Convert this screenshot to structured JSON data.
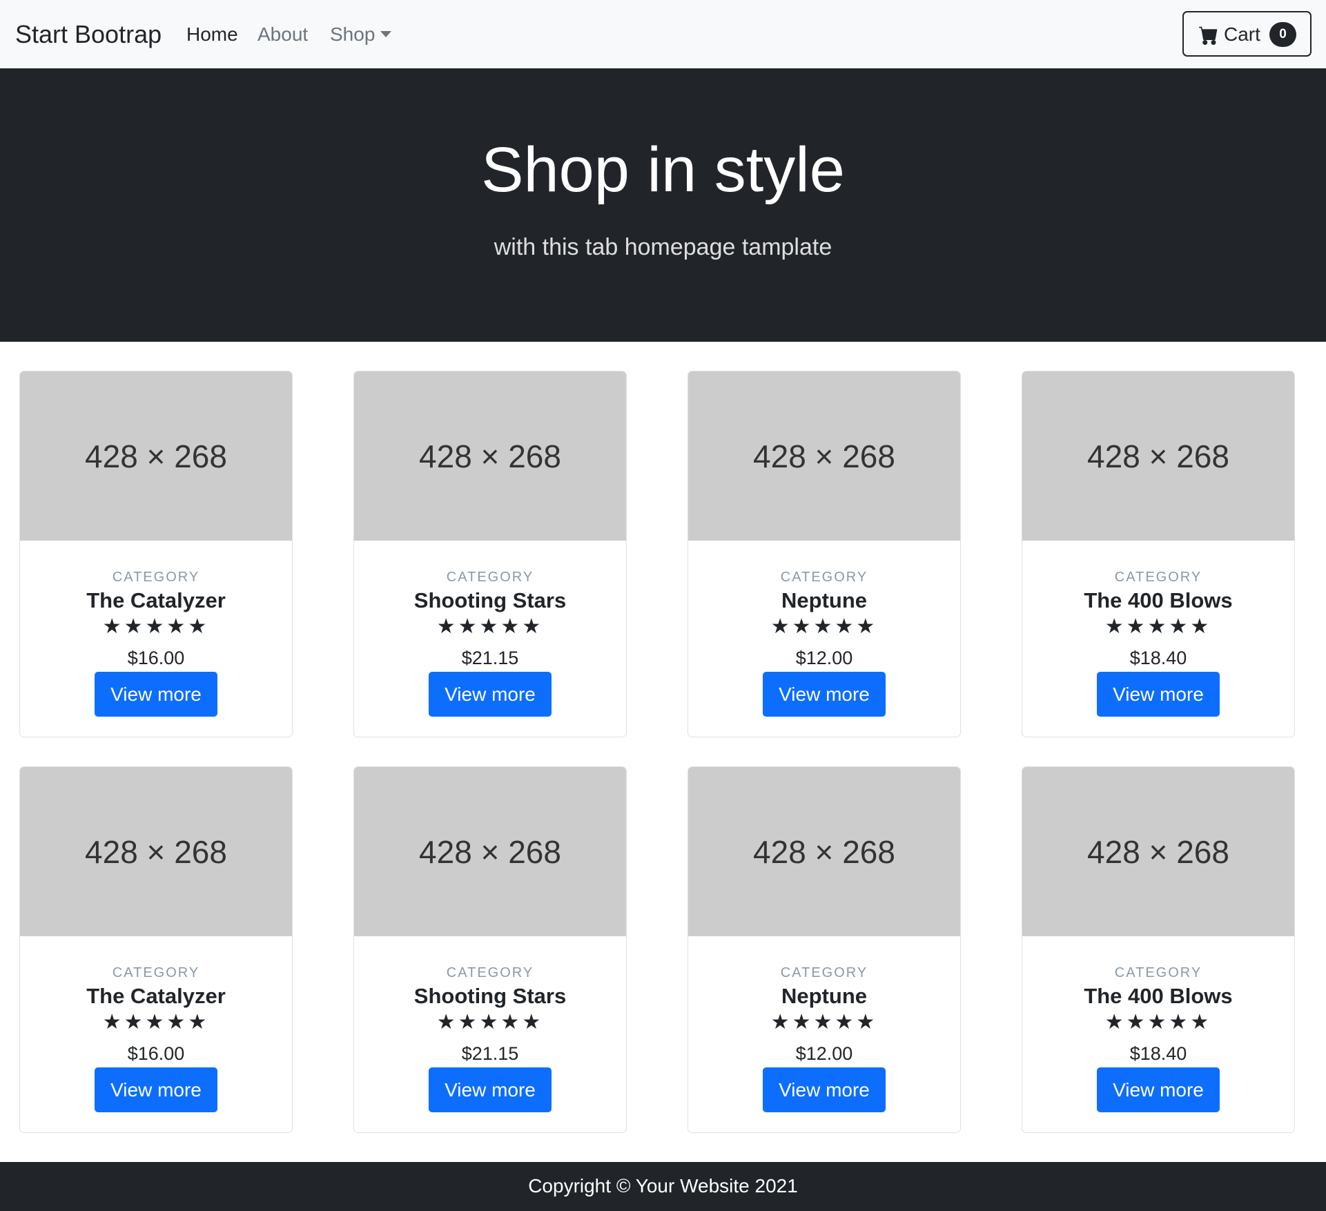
{
  "navbar": {
    "brand": "Start Bootrap",
    "links": {
      "home": "Home",
      "about": "About",
      "shop": "Shop"
    },
    "cart": {
      "label": "Cart",
      "count": "0"
    }
  },
  "hero": {
    "title": "Shop in style",
    "subtitle": "with this tab homepage tamplate"
  },
  "products": [
    {
      "image_text": "428 × 268",
      "category": "CATEGORY",
      "name": "The Catalyzer",
      "stars": "★★★★★",
      "price": "$16.00",
      "button": "View more"
    },
    {
      "image_text": "428 × 268",
      "category": "CATEGORY",
      "name": "Shooting Stars",
      "stars": "★★★★★",
      "price": "$21.15",
      "button": "View more"
    },
    {
      "image_text": "428 × 268",
      "category": "CATEGORY",
      "name": "Neptune",
      "stars": "★★★★★",
      "price": "$12.00",
      "button": "View more"
    },
    {
      "image_text": "428 × 268",
      "category": "CATEGORY",
      "name": "The 400 Blows",
      "stars": "★★★★★",
      "price": "$18.40",
      "button": "View more"
    },
    {
      "image_text": "428 × 268",
      "category": "CATEGORY",
      "name": "The Catalyzer",
      "stars": "★★★★★",
      "price": "$16.00",
      "button": "View more"
    },
    {
      "image_text": "428 × 268",
      "category": "CATEGORY",
      "name": "Shooting Stars",
      "stars": "★★★★★",
      "price": "$21.15",
      "button": "View more"
    },
    {
      "image_text": "428 × 268",
      "category": "CATEGORY",
      "name": "Neptune",
      "stars": "★★★★★",
      "price": "$12.00",
      "button": "View more"
    },
    {
      "image_text": "428 × 268",
      "category": "CATEGORY",
      "name": "The 400 Blows",
      "stars": "★★★★★",
      "price": "$18.40",
      "button": "View more"
    }
  ],
  "footer": {
    "copyright": "Copyright © Your Website 2021"
  },
  "colors": {
    "primary": "#0d6efd",
    "dark": "#212529",
    "light": "#f8f9fa",
    "placeholder": "#cccccc"
  }
}
